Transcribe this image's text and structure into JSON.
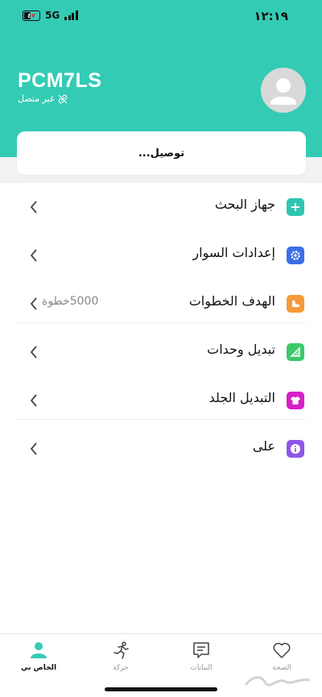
{
  "status_bar": {
    "time": "١٢:١٩",
    "battery": "٤٧",
    "network": "5G"
  },
  "header": {
    "device_name": "PCM7LS",
    "connection_status": "غير متصل"
  },
  "connect_card": {
    "label": "توصيل..."
  },
  "menu": {
    "items": [
      {
        "label": "جهاز البحث",
        "icon": "plus-icon",
        "color": "#2fc6b0",
        "value": ""
      },
      {
        "label": "إعدادات السوار",
        "icon": "gear-icon",
        "color": "#3d6ee8",
        "value": ""
      },
      {
        "label": "الهدف الخطوات",
        "icon": "shoe-icon",
        "color": "#f59a3a",
        "value": "5000خطوة"
      },
      {
        "label": "تبديل وحدات",
        "icon": "ruler-icon",
        "color": "#3cc96a",
        "value": ""
      },
      {
        "label": "التبديل الجلد",
        "icon": "shirt-icon",
        "color": "#d61fc9",
        "value": ""
      },
      {
        "label": "على",
        "icon": "info-icon",
        "color": "#8e56e8",
        "value": ""
      }
    ]
  },
  "tabbar": {
    "tabs": [
      {
        "label": "الخاص بي",
        "icon": "person-icon",
        "active": true
      },
      {
        "label": "حركة",
        "icon": "running-icon",
        "active": false
      },
      {
        "label": "البيانات",
        "icon": "chat-data-icon",
        "active": false
      },
      {
        "label": "الصحة",
        "icon": "heart-icon",
        "active": false
      }
    ]
  },
  "colors": {
    "accent": "#34cbb5",
    "background_band": "#f2f2f2"
  }
}
